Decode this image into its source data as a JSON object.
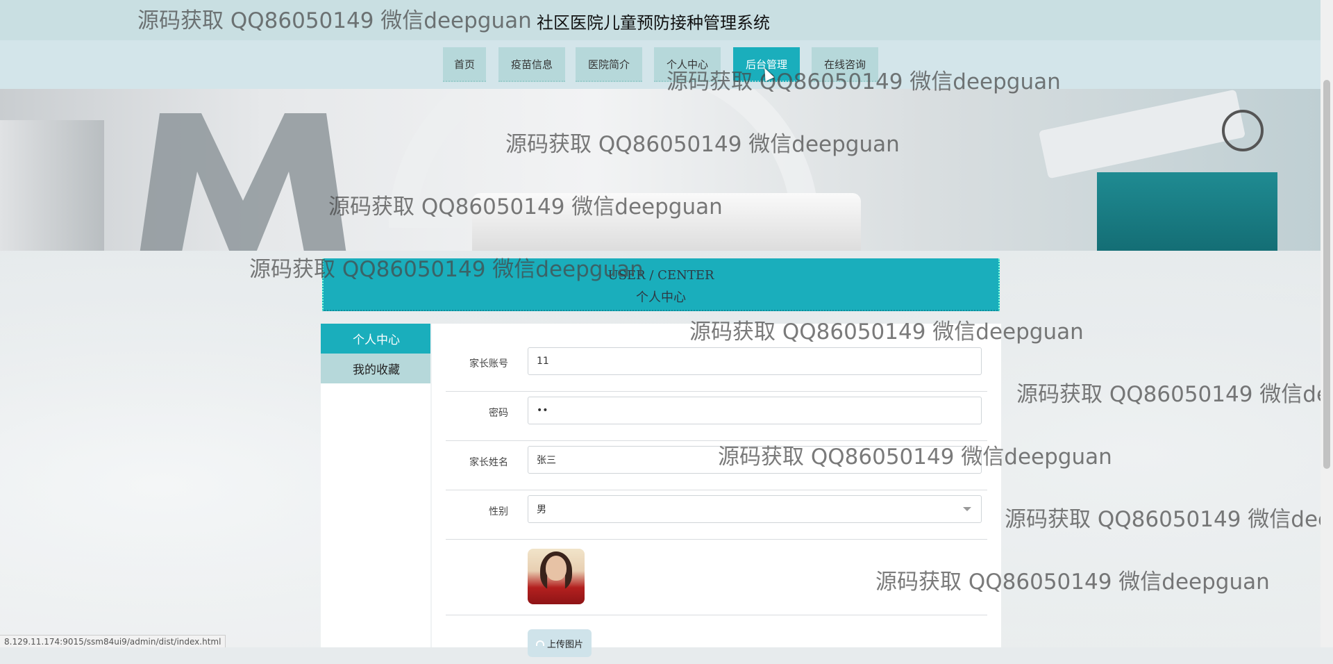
{
  "header": {
    "title": "社区医院儿童预防接种管理系统"
  },
  "nav": {
    "items": [
      {
        "label": "首页"
      },
      {
        "label": "疫苗信息"
      },
      {
        "label": "医院简介"
      },
      {
        "label": "个人中心"
      },
      {
        "label": "后台管理"
      },
      {
        "label": "在线咨询"
      }
    ],
    "active": "后台管理"
  },
  "user_center": {
    "title_en": "USER / CENTER",
    "title_cn": "个人中心"
  },
  "side_menu": {
    "items": [
      {
        "label": "个人中心"
      },
      {
        "label": "我的收藏"
      }
    ],
    "active": "个人中心"
  },
  "form": {
    "account": {
      "label": "家长账号",
      "value": "11"
    },
    "password": {
      "label": "密码",
      "value": "••"
    },
    "name": {
      "label": "家长姓名",
      "value": "张三"
    },
    "gender": {
      "label": "性别",
      "value": "男"
    },
    "upload_label": "上传图片"
  },
  "watermark": "源码获取 QQ86050149 微信deepguan",
  "status_url": "8.129.11.174:9015/ssm84ui9/admin/dist/index.html",
  "colors": {
    "accent": "#1aaebc",
    "nav_bg": "#b6d8da",
    "header_bg": "#c9dfe2"
  }
}
